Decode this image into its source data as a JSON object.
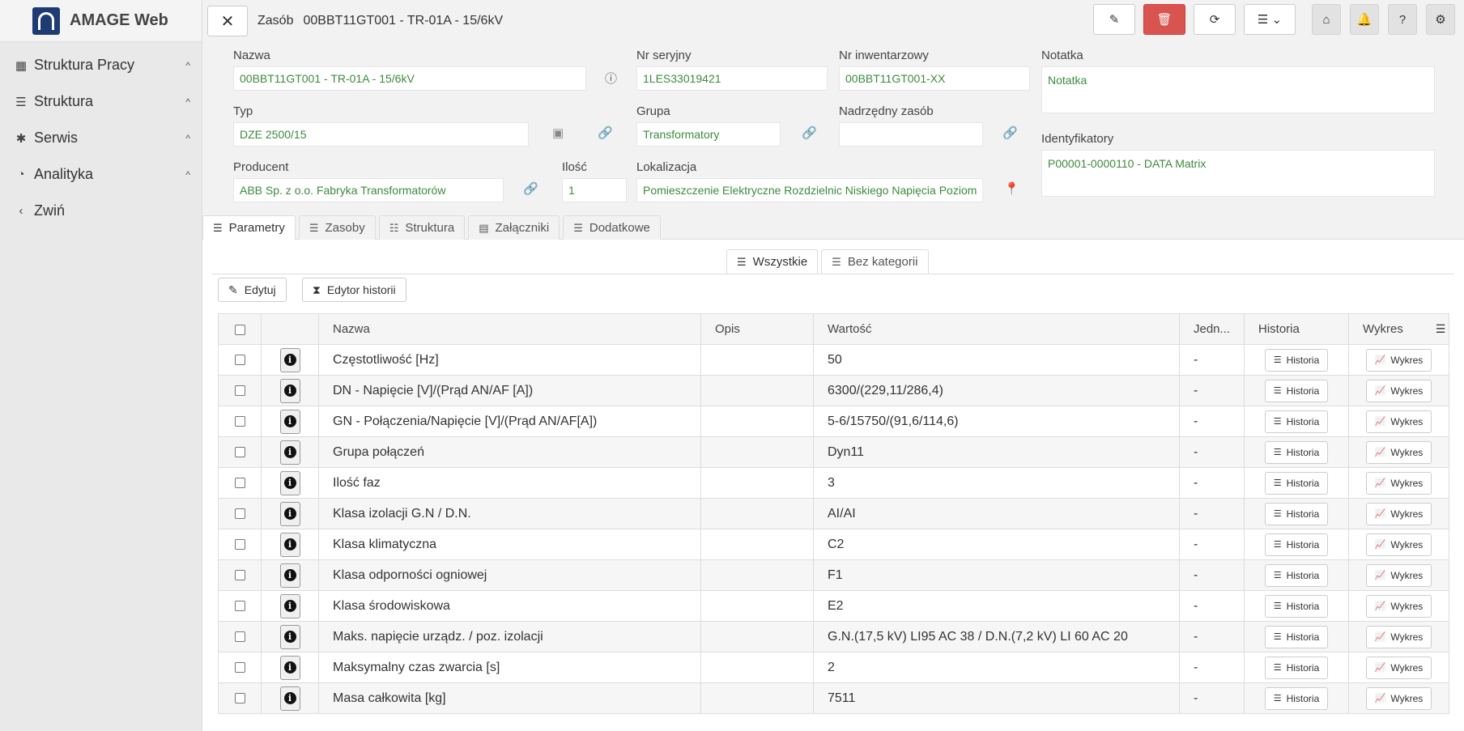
{
  "app": {
    "title": "AMAGE Web"
  },
  "sidebar": {
    "items": [
      {
        "label": "Struktura Pracy",
        "icon": "building-icon",
        "glyph": "▦",
        "chevron": "^"
      },
      {
        "label": "Struktura",
        "icon": "sitemap-icon",
        "glyph": "☰",
        "chevron": "^"
      },
      {
        "label": "Serwis",
        "icon": "bug-icon",
        "glyph": "✱",
        "chevron": "^"
      },
      {
        "label": "Analityka",
        "icon": "dashboard-icon",
        "glyph": "◔",
        "chevron": "^"
      },
      {
        "label": "Zwiń",
        "icon": "chevron-left-icon",
        "glyph": "‹",
        "chevron": ""
      }
    ]
  },
  "header": {
    "close_glyph": "✕",
    "prefix": "Zasób",
    "title": "00BBT11GT001 - TR-01A - 15/6kV",
    "actions": {
      "edit": "✎",
      "delete": "🗑",
      "refresh": "⟳",
      "menu": "☰ ⌄",
      "home": "⌂",
      "bell": "🔔",
      "help": "?",
      "settings": "⚙"
    }
  },
  "form": {
    "nazwa": {
      "label": "Nazwa",
      "value": "00BBT11GT001 - TR-01A - 15/6kV"
    },
    "nr_seryjny": {
      "label": "Nr seryjny",
      "value": "1LES33019421"
    },
    "nr_inwentarzowy": {
      "label": "Nr inwentarzowy",
      "value": "00BBT11GT001-XX"
    },
    "notatka": {
      "label": "Notatka",
      "value": "Notatka"
    },
    "typ": {
      "label": "Typ",
      "value": "DZE 2500/15"
    },
    "grupa": {
      "label": "Grupa",
      "value": "Transformatory"
    },
    "nadrzedny": {
      "label": "Nadrzędny zasób",
      "value": ""
    },
    "identyfikatory": {
      "label": "Identyfikatory",
      "value": "P00001-0000110 - DATA Matrix"
    },
    "producent": {
      "label": "Producent",
      "value": "ABB Sp. z o.o. Fabryka Transformatorów"
    },
    "ilosc": {
      "label": "Ilość",
      "value": "1"
    },
    "lokalizacja": {
      "label": "Lokalizacja",
      "value": "Pomieszczenie Elektryczne Rozdzielnic Niskiego Napięcia Poziom"
    },
    "icons": {
      "info": "ⓘ",
      "image": "▣",
      "link": "🔗",
      "pin": "📍"
    }
  },
  "tabs": [
    {
      "label": "Parametry",
      "glyph": "☰"
    },
    {
      "label": "Zasoby",
      "glyph": "☰"
    },
    {
      "label": "Struktura",
      "glyph": "☷"
    },
    {
      "label": "Załączniki",
      "glyph": "▤"
    },
    {
      "label": "Dodatkowe",
      "glyph": "☰"
    }
  ],
  "subtabs": [
    {
      "label": "Wszystkie",
      "glyph": "☰"
    },
    {
      "label": "Bez kategorii",
      "glyph": "☰"
    }
  ],
  "toolbar": {
    "edit_label": "Edytuj",
    "edit_glyph": "✎",
    "history_label": "Edytor historii",
    "history_glyph": "⧗"
  },
  "table": {
    "columns": [
      "Nazwa",
      "Opis",
      "Wartość",
      "Jedn...",
      "Historia",
      "Wykres"
    ],
    "col_menu_glyph": "☰",
    "row_history_label": "Historia",
    "row_history_glyph": "☰",
    "row_chart_label": "Wykres",
    "row_chart_glyph": "📈",
    "info_glyph": "i",
    "rows": [
      {
        "name": "Częstotliwość [Hz]",
        "desc": "",
        "value": "50",
        "unit": "-"
      },
      {
        "name": "DN - Napięcie [V]/(Prąd AN/AF [A])",
        "desc": "",
        "value": "6300/(229,11/286,4)",
        "unit": "-"
      },
      {
        "name": "GN - Połączenia/Napięcie [V]/(Prąd AN/AF[A])",
        "desc": "",
        "value": "5-6/15750/(91,6/114,6)",
        "unit": "-"
      },
      {
        "name": "Grupa połączeń",
        "desc": "",
        "value": "Dyn11",
        "unit": "-"
      },
      {
        "name": "Ilość faz",
        "desc": "",
        "value": "3",
        "unit": "-"
      },
      {
        "name": "Klasa izolacji G.N / D.N.",
        "desc": "",
        "value": "AI/AI",
        "unit": "-"
      },
      {
        "name": "Klasa klimatyczna",
        "desc": "",
        "value": "C2",
        "unit": "-"
      },
      {
        "name": "Klasa odporności ogniowej",
        "desc": "",
        "value": "F1",
        "unit": "-"
      },
      {
        "name": "Klasa środowiskowa",
        "desc": "",
        "value": "E2",
        "unit": "-"
      },
      {
        "name": "Maks. napięcie urządz. / poz. izolacji",
        "desc": "",
        "value": "G.N.(17,5 kV) LI95 AC 38 / D.N.(7,2 kV) LI 60 AC 20",
        "unit": "-"
      },
      {
        "name": "Maksymalny czas zwarcia [s]",
        "desc": "",
        "value": "2",
        "unit": "-"
      },
      {
        "name": "Masa całkowita [kg]",
        "desc": "",
        "value": "7511",
        "unit": "-"
      }
    ]
  }
}
